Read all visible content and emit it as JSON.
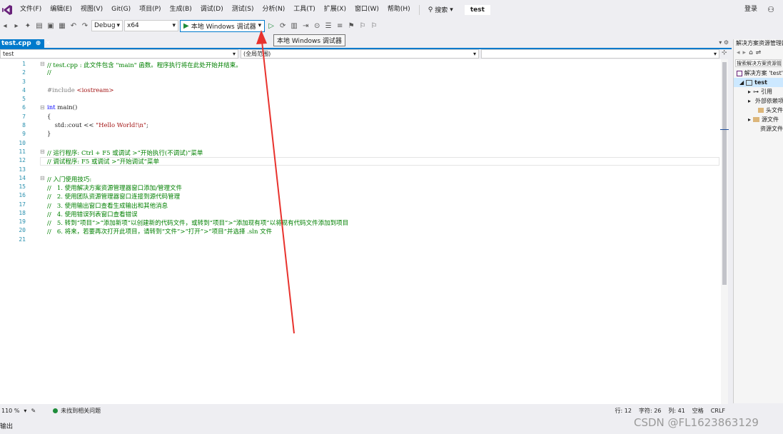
{
  "menubar": {
    "items": [
      "文件(F)",
      "编辑(E)",
      "视图(V)",
      "Git(G)",
      "项目(P)",
      "生成(B)",
      "调试(D)",
      "测试(S)",
      "分析(N)",
      "工具(T)",
      "扩展(X)",
      "窗口(W)",
      "帮助(H)"
    ],
    "search_label": "搜索",
    "solution_title": "test",
    "login": "登录"
  },
  "toolbar": {
    "configuration": "Debug",
    "platform": "x64",
    "run_label": "本地 Windows 调试器",
    "tooltip": "本地 Windows 调试器"
  },
  "tab": {
    "filename": "test.cpp",
    "pin": "⊕",
    "close": "✕"
  },
  "navbar": {
    "project": "test",
    "scope": "(全局范围)",
    "member": ""
  },
  "editor": {
    "line_numbers": [
      "1",
      "2",
      "3",
      "4",
      "5",
      "6",
      "7",
      "8",
      "9",
      "10",
      "11",
      "12",
      "13",
      "14",
      "15",
      "16",
      "17",
      "18",
      "19",
      "20",
      "21"
    ],
    "lines": {
      "l1": "// test.cpp : 此文件包含 \"main\" 函数。程序执行将在此处开始并结束。",
      "l2": "//",
      "l4_pp": "#include ",
      "l4_st": "<iostream>",
      "l6_kw": "int",
      "l6_rest": " main()",
      "l7": "{",
      "l8_a": "    std::cout << ",
      "l8_st": "\"Hello World!\\n\"",
      "l8_b": ";",
      "l9": "}",
      "l11": "// 运行程序: Ctrl + F5 或调试 >“开始执行(不调试)”菜单",
      "l12": "// 调试程序: F5 或调试 >“开始调试”菜单",
      "l14": "// 入门使用技巧:",
      "l15": "//   1. 使用解决方案资源管理器窗口添加/管理文件",
      "l16": "//   2. 使用团队资源管理器窗口连接到源代码管理",
      "l17": "//   3. 使用输出窗口查看生成输出和其他消息",
      "l18": "//   4. 使用错误列表窗口查看错误",
      "l19": "//   5. 转到“项目”>“添加新项”以创建新的代码文件，或转到“项目”>“添加现有项”以将现有代码文件添加到项目",
      "l20": "//   6. 将来，若要再次打开此项目，请转到“文件”>“打开”>“项目”并选择 .sln 文件"
    }
  },
  "statusbar": {
    "zoom": "110 %",
    "issues": "未找到相关问题",
    "line": "行: 12",
    "char": "字符: 26",
    "col": "列: 41",
    "indent": "空格",
    "eol": "CRLF"
  },
  "output": {
    "title": "输出"
  },
  "solution_explorer": {
    "header": "解决方案资源管理器",
    "search_placeholder": "搜索解决方案资源管理器",
    "solution": "解决方案 'test'",
    "project": "test",
    "nodes": [
      "引用",
      "外部依赖项",
      "头文件",
      "源文件",
      "资源文件"
    ]
  },
  "watermark": "CSDN @FL1623863129",
  "colors": {
    "accent": "#007acc",
    "comment": "#008000",
    "keyword": "#0000ff",
    "string": "#a31515",
    "annotation_arrow": "#e8322d"
  }
}
